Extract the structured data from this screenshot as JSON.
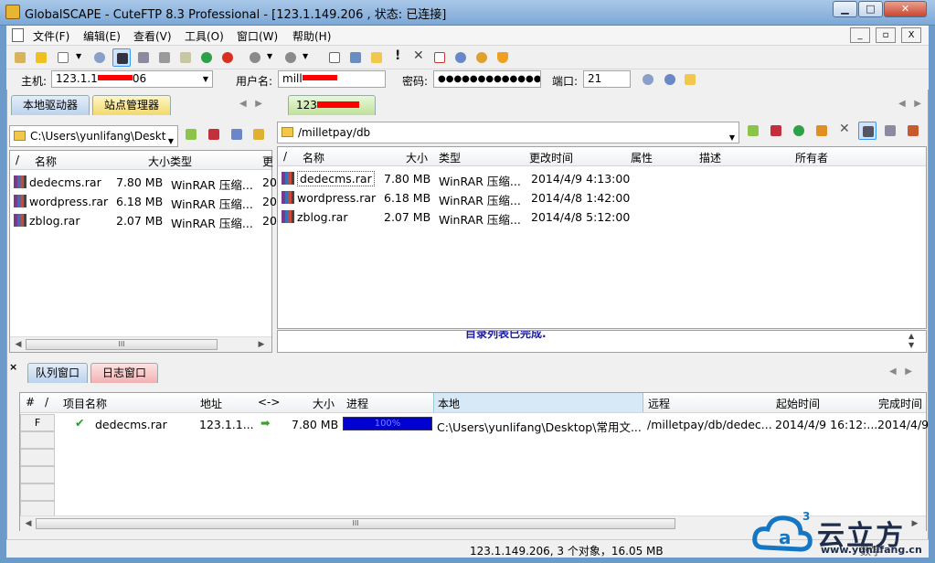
{
  "window": {
    "title": "GlobalSCAPE - CuteFTP 8.3 Professional - [123.1.149.206 , 状态: 已连接]",
    "min": "▁",
    "max": "□",
    "close": "✕"
  },
  "menu": [
    "文件(F)",
    "编辑(E)",
    "查看(V)",
    "工具(O)",
    "窗口(W)",
    "帮助(H)"
  ],
  "mdi": {
    "min": "_",
    "restore": "▫",
    "close": "X"
  },
  "quickconnect": {
    "host_label": "主机:",
    "host_value": "123.1.1",
    "host_suffix": "06",
    "user_label": "用户名:",
    "user_value": "mill",
    "pass_label": "密码:",
    "pass_value": "●●●●●●●●●●●●●●",
    "port_label": "端口:",
    "port_value": "21"
  },
  "left": {
    "tabs": [
      "本地驱动器",
      "站点管理器"
    ],
    "path": "C:\\Users\\yunlifang\\Deskt",
    "columns": [
      "/",
      "名称",
      "大小",
      "类型",
      "更"
    ],
    "files": [
      {
        "name": "dedecms.rar",
        "size": "7.80 MB",
        "type": "WinRAR 压缩...",
        "extra": "20"
      },
      {
        "name": "wordpress.rar",
        "size": "6.18 MB",
        "type": "WinRAR 压缩...",
        "extra": "20"
      },
      {
        "name": "zblog.rar",
        "size": "2.07 MB",
        "type": "WinRAR 压缩...",
        "extra": "20"
      }
    ]
  },
  "right": {
    "tab": "123",
    "path": "/milletpay/db",
    "columns": [
      "/",
      "名称",
      "大小",
      "类型",
      "更改时间",
      "属性",
      "描述",
      "所有者"
    ],
    "files": [
      {
        "name": "dedecms.rar",
        "size": "7.80 MB",
        "type": "WinRAR 压缩...",
        "time": "2014/4/9 4:13:00"
      },
      {
        "name": "wordpress.rar",
        "size": "6.18 MB",
        "type": "WinRAR 压缩...",
        "time": "2014/4/8 1:42:00"
      },
      {
        "name": "zblog.rar",
        "size": "2.07 MB",
        "type": "WinRAR 压缩...",
        "time": "2014/4/8 5:12:00"
      }
    ],
    "log_fragment": "目录列表已完成."
  },
  "queue": {
    "tabs": [
      "队列窗口",
      "日志窗口"
    ],
    "close": "×",
    "columns": [
      "#",
      "/",
      "项目名称",
      "地址",
      "<->",
      "大小",
      "进程",
      "本地",
      "远程",
      "起始时间",
      "完成时间"
    ],
    "rows": [
      {
        "flag": "F",
        "name": "dedecms.rar",
        "address": "123.1.1...",
        "size": "7.80 MB",
        "progress": 1.0,
        "progress_label": "100%",
        "local": "C:\\Users\\yunlifang\\Desktop\\常用文...",
        "remote": "/milletpay/db/dedec...",
        "start": "2014/4/9 16:12:...",
        "end": "2014/4/9"
      }
    ]
  },
  "status": {
    "text": "123.1.149.206, 3 个对象，16.05 MB",
    "extra": "数字"
  },
  "watermark": {
    "brand": "云立方",
    "url": "www.yunlifang.cn"
  },
  "scroll": {
    "thumb": "III"
  },
  "colors": {
    "progress": "#0000d0",
    "title_gradient_top": "#a9c8e8",
    "selected_header": "#d7e8f7"
  }
}
